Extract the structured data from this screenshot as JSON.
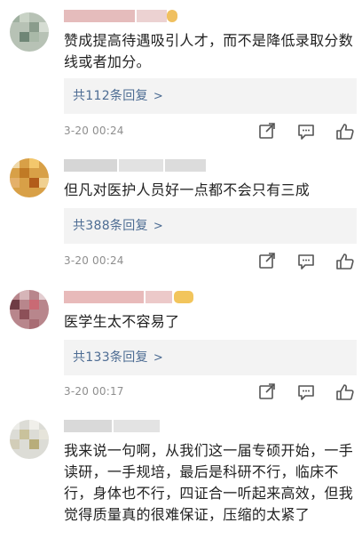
{
  "comments": [
    {
      "text": "赞成提高待遇吸引人才，而不是降低录取分数线或者加分。",
      "replies_label": "共112条回复",
      "timestamp": "3-20 00:24"
    },
    {
      "text": "但凡对医护人员好一点都不会只有三成",
      "replies_label": "共388条回复",
      "timestamp": "3-20 00:24"
    },
    {
      "text": "医学生太不容易了",
      "replies_label": "共133条回复",
      "timestamp": "3-20 00:17"
    },
    {
      "text": "我来说一句啊，从我们这一届专硕开始，一手读研，一手规培，最后是科研不行，临床不行，身体也不行，四证合一听起来高效，但我觉得质量真的很难保证，压缩的太紧了"
    }
  ],
  "icons": {
    "share": "share-icon",
    "comment": "comment-icon",
    "like": "like-icon",
    "reply_chevron": "chevron-right-icon"
  },
  "colors": {
    "link": "#4d6c93",
    "reply_box_bg": "#f3f3f3",
    "meta": "#8e8e8e",
    "text": "#222222"
  }
}
